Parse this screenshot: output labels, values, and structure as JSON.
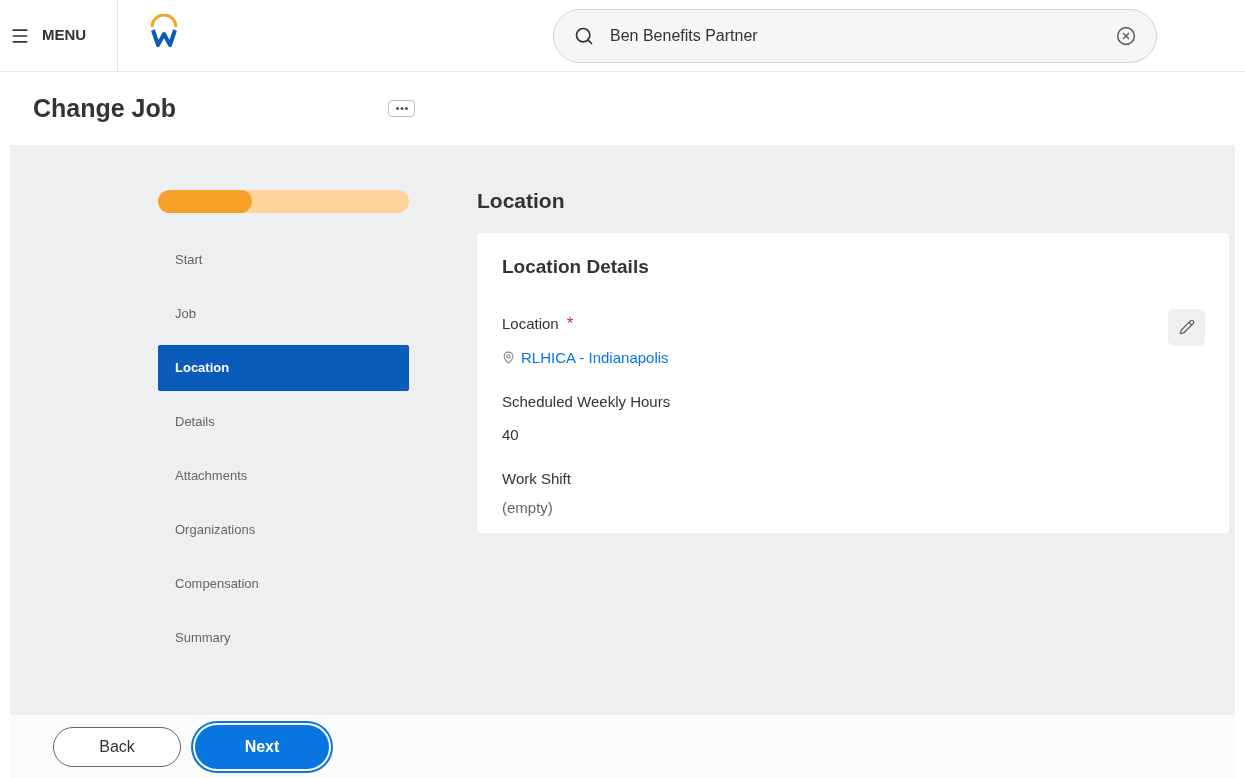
{
  "header": {
    "menu_label": "MENU",
    "search": {
      "value": "Ben Benefits Partner"
    }
  },
  "page_title": "Change Job",
  "progress": {
    "level": 0.375
  },
  "steps": [
    {
      "label": "Start",
      "selected": false
    },
    {
      "label": "Job",
      "selected": false
    },
    {
      "label": "Location",
      "selected": true
    },
    {
      "label": "Details",
      "selected": false
    },
    {
      "label": "Attachments",
      "selected": false
    },
    {
      "label": "Organizations",
      "selected": false
    },
    {
      "label": "Compensation",
      "selected": false
    },
    {
      "label": "Summary",
      "selected": false
    }
  ],
  "section_title": "Location",
  "card": {
    "title": "Location Details",
    "fields": [
      {
        "label": "Location",
        "required": true,
        "kind": "link",
        "value": "RLHICA - Indianapolis"
      },
      {
        "label": "Scheduled Weekly Hours",
        "required": false,
        "kind": "text",
        "value": "40"
      },
      {
        "label": "Work Shift",
        "required": false,
        "kind": "muted",
        "value": "(empty)"
      }
    ]
  },
  "required_mark": "*",
  "buttons": [
    {
      "label": "Back",
      "kind": "secondary"
    },
    {
      "label": "Next",
      "kind": "primary"
    }
  ]
}
